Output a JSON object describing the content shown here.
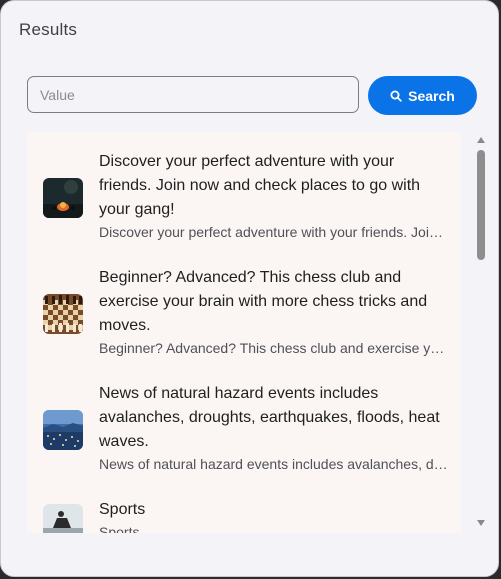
{
  "dialog": {
    "title": "Results"
  },
  "search": {
    "placeholder": "Value",
    "value": "",
    "button_label": "Search"
  },
  "results": [
    {
      "title": "Discover your perfect adventure with your friends. Join now and check places to go with your gang!",
      "subtitle": "Discover your perfect adventure with your friends. Join now and check places to go with your gang!",
      "thumbnail": "campfire-night-image"
    },
    {
      "title": "Beginner? Advanced? This chess club and exercise your brain with more chess tricks and moves.",
      "subtitle": "Beginner? Advanced? This chess club and exercise your brain with more chess tricks and moves.",
      "thumbnail": "chessboard-image"
    },
    {
      "title": "News of natural hazard events includes avalanches, droughts, earthquakes, floods, heat waves.",
      "subtitle": "News of natural hazard events includes avalanches, droughts, earthquakes, floods, heat waves.",
      "thumbnail": "city-night-image"
    },
    {
      "title": "Sports",
      "subtitle": "Sports",
      "thumbnail": "sports-image"
    }
  ],
  "colors": {
    "accent": "#0a73e8",
    "list_background": "#fbf6f4",
    "dialog_background": "#f4f3f8"
  }
}
